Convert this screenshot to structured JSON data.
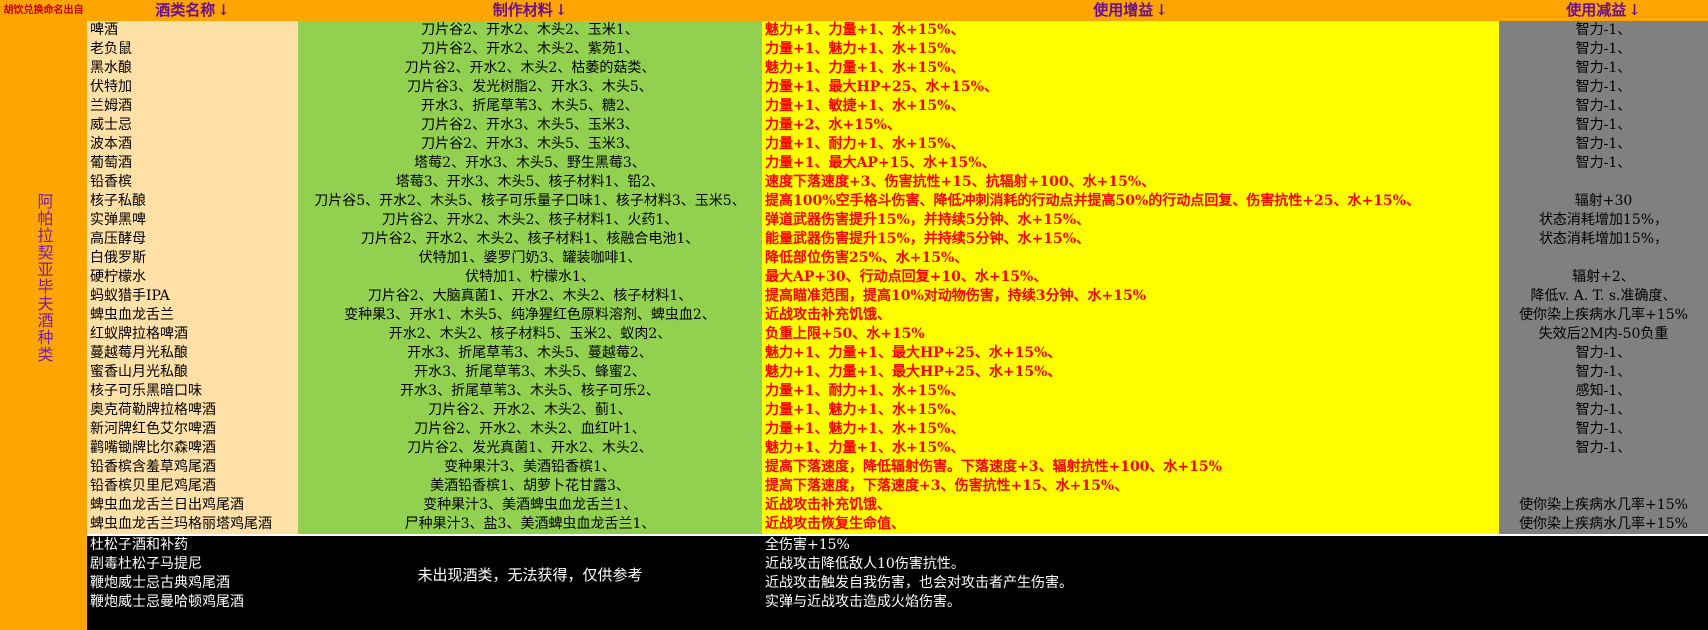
{
  "header": {
    "corner": "胡饮兑换命名出自",
    "columns": [
      "酒类名称",
      "制作材料",
      "使用增益",
      "使用减益"
    ],
    "arrow": "↓"
  },
  "side_label": "阿帕拉契亚毕夫酒种类",
  "rows": [
    {
      "name": "啤酒",
      "materials": "刀片谷2、开水2、木头2、玉米1、",
      "buff": "魅力+1、力量+1、水+15%、",
      "debuff": "智力-1、"
    },
    {
      "name": "老负鼠",
      "materials": "刀片谷2、开水2、木头2、紫苑1、",
      "buff": "力量+1、魅力+1、水+15%、",
      "debuff": "智力-1、"
    },
    {
      "name": "黑水酿",
      "materials": "刀片谷2、开水2、木头2、枯萎的菇类、",
      "buff": "魅力+1、力量+1、水+15%、",
      "debuff": "智力-1、"
    },
    {
      "name": "伏特加",
      "materials": "刀片谷3、发光树脂2、开水3、木头5、",
      "buff": "力量+1、最大HP+25、水+15%、",
      "debuff": "智力-1、"
    },
    {
      "name": "兰姆酒",
      "materials": "开水3、折尾草苇3、木头5、糖2、",
      "buff": "力量+1、敏捷+1、水+15%、",
      "debuff": "智力-1、"
    },
    {
      "name": "威士忌",
      "materials": "刀片谷2、开水3、木头5、玉米3、",
      "buff": "力量+2、水+15%、",
      "debuff": "智力-1、"
    },
    {
      "name": "波本酒",
      "materials": "刀片谷2、开水3、木头5、玉米3、",
      "buff": "力量+1、耐力+1、水+15%、",
      "debuff": "智力-1、"
    },
    {
      "name": "葡萄酒",
      "materials": "塔莓2、开水3、木头5、野生黑莓3、",
      "buff": "力量+1、最大AP+15、水+15%、",
      "debuff": "智力-1、"
    },
    {
      "name": "铅香槟",
      "materials": "塔莓3、开水3、木头5、核子材料1、铅2、",
      "buff": "速度下落速度+3、伤害抗性+15、抗辐射+100、水+15%、",
      "debuff": ""
    },
    {
      "name": "核子私酿",
      "materials": "刀片谷5、开水2、木头5、核子可乐量子口味1、核子材料3、玉米5、",
      "buff": "提高100%空手格斗伤害、降低冲刺消耗的行动点并提高50%的行动点回复、伤害抗性+25、水+15%、",
      "debuff": "辐射+30"
    },
    {
      "name": "实弹黑啤",
      "materials": "刀片谷2、开水2、木头2、核子材料1、火药1、",
      "buff": "弹道武器伤害提升15%，并持续5分钟、水+15%、",
      "debuff": "状态消耗增加15%，"
    },
    {
      "name": "高压酵母",
      "materials": "刀片谷2、开水2、木头2、核子材料1、核融合电池1、",
      "buff": "能量武器伤害提升15%，并持续5分钟、水+15%、",
      "debuff": "状态消耗增加15%，"
    },
    {
      "name": "白俄罗斯",
      "materials": "伏特加1、婆罗门奶3、罐装咖啡1、",
      "buff": "降低部位伤害25%、水+15%、",
      "debuff": ""
    },
    {
      "name": "硬柠檬水",
      "materials": "伏特加1、柠檬水1、",
      "buff": "最大AP+30、行动点回复+10、水+15%、",
      "debuff": "辐射+2、"
    },
    {
      "name": "蚂蚁猎手IPA",
      "materials": "刀片谷2、大脑真菌1、开水2、木头2、核子材料1、",
      "buff": "提高瞄准范围，提高10%对动物伤害，持续3分钟、水+15%",
      "debuff": "降低v. A. T. s.准确度、"
    },
    {
      "name": "蜱虫血龙舌兰",
      "materials": "变种果3、开水1、木头5、纯净猩红色原料溶剂、蜱虫血2、",
      "buff": "近战攻击补充饥饿、",
      "debuff": "使你染上疾病水几率+15%"
    },
    {
      "name": "红蚁牌拉格啤酒",
      "materials": "开水2、木头2、核子材料5、玉米2、蚁肉2、",
      "buff": "负重上限+50、水+15%",
      "debuff": "失效后2M内-50负重"
    },
    {
      "name": "蔓越莓月光私酿",
      "materials": "开水3、折尾草苇3、木头5、蔓越莓2、",
      "buff": "魅力+1、力量+1、最大HP+25、水+15%、",
      "debuff": "智力-1、"
    },
    {
      "name": "蜜香山月光私酿",
      "materials": "开水3、折尾草苇3、木头5、蜂蜜2、",
      "buff": "魅力+1、力量+1、最大HP+25、水+15%、",
      "debuff": "智力-1、"
    },
    {
      "name": "核子可乐黑暗口味",
      "materials": "开水3、折尾草苇3、木头5、核子可乐2、",
      "buff": "力量+1、耐力+1、水+15%、",
      "debuff": "感知-1、"
    },
    {
      "name": "奥克荷勒牌拉格啤酒",
      "materials": "刀片谷2、开水2、木头2、蓟1、",
      "buff": "力量+1、魅力+1、水+15%、",
      "debuff": "智力-1、"
    },
    {
      "name": "新河牌红色艾尔啤酒",
      "materials": "刀片谷2、开水2、木头2、血红叶1、",
      "buff": "力量+1、魅力+1、水+15%、",
      "debuff": "智力-1、"
    },
    {
      "name": "鹳嘴锄牌比尔森啤酒",
      "materials": "刀片谷2、发光真菌1、开水2、木头2、",
      "buff": "魅力+1、力量+1、水+15%、",
      "debuff": "智力-1、"
    },
    {
      "name": "铅香槟含羞草鸡尾酒",
      "materials": "变种果汁3、美酒铅香槟1、",
      "buff": "提高下落速度，降低辐射伤害。下落速度+3、辐射抗性+100、水+15%",
      "debuff": ""
    },
    {
      "name": "铅香槟贝里尼鸡尾酒",
      "materials": "美酒铅香槟1、胡萝卜花甘露3、",
      "buff": "提高下落速度，下落速度+3、伤害抗性+15、水+15%、",
      "debuff": ""
    },
    {
      "name": "蜱虫血龙舌兰日出鸡尾酒",
      "materials": "变种果汁3、美酒蜱虫血龙舌兰1、",
      "buff": "近战攻击补充饥饿、",
      "debuff": "使你染上疾病水几率+15%"
    },
    {
      "name": "蜱虫血龙舌兰玛格丽塔鸡尾酒",
      "materials": "尸种果汁3、盐3、美酒蜱虫血龙舌兰1、",
      "buff": "近战攻击恢复生命值、",
      "debuff": "使你染上疾病水几率+15%"
    }
  ],
  "unobtained": {
    "names": [
      "杜松子酒和补药",
      "剧毒杜松子马提尼",
      "鞭炮威士忌古典鸡尾酒",
      "鞭炮威士忌曼哈顿鸡尾酒"
    ],
    "note": "未出现酒类，无法获得，仅供参考",
    "buffs": [
      "全伤害+15%",
      "近战攻击降低敌人10伤害抗性。",
      "近战攻击触发自我伤害，也会对攻击者产生伤害。",
      "实弹与近战攻击造成火焰伤害。"
    ]
  },
  "colors": {
    "header_bg": "#ffa500",
    "header_text": "#6a0f8e",
    "name_col": "#ffe0a6",
    "materials_col": "#92d050",
    "buff_col": "#ffff00",
    "buff_text": "#ff0000",
    "debuff_col": "#808080",
    "unobtained_bg": "#000000"
  }
}
